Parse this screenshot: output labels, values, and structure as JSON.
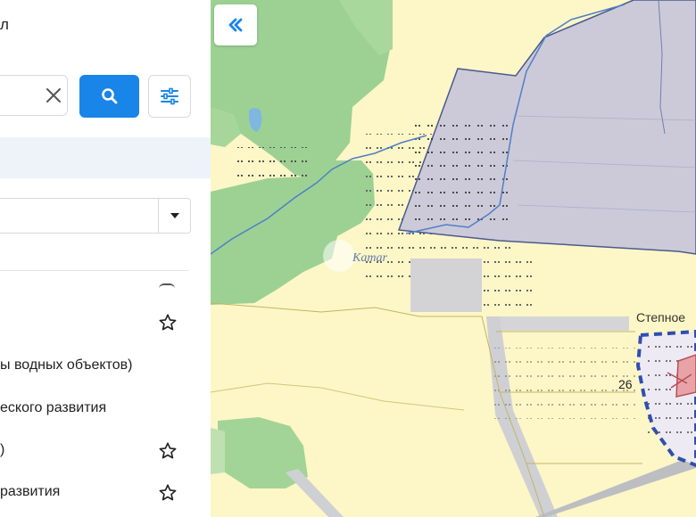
{
  "panel": {
    "title_fragment": "л",
    "search": {
      "value": "",
      "placeholder": ""
    },
    "list_items": [
      {
        "label": "",
        "starred": false
      },
      {
        "label": "ы водных объектов)",
        "starred": false
      },
      {
        "label": "еского развития",
        "starred": false
      },
      {
        "label": ")",
        "starred": false
      },
      {
        "label": "развития",
        "starred": false
      }
    ]
  },
  "map": {
    "labels": {
      "village": "Степное",
      "parcel_number": "26",
      "watermark": "Kamar"
    },
    "colors": {
      "background": "#fdf6c7",
      "forest": "#9cd193",
      "protected_zone": "#cccad8",
      "zone_border": "#4a5a8c",
      "settlement_border": "#2f4fb0",
      "water": "#4f7fc9",
      "accent": "#1a85e8"
    }
  },
  "icons": {
    "clear": "close-icon",
    "search": "search-icon",
    "filter": "filter-sliders-icon",
    "caret": "caret-down-icon",
    "star": "star-outline-icon",
    "collapse": "double-chevron-left-icon"
  }
}
